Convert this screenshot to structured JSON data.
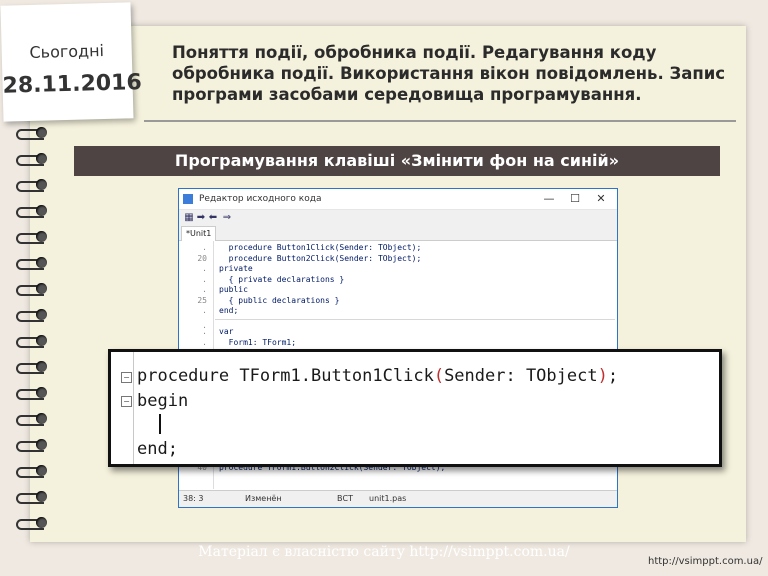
{
  "note": {
    "label": "Сьогодні",
    "date": "28.11.2016"
  },
  "title": "Поняття події, обробника події. Редагування коду обробника події. Використання вікон повідомлень. Запис програми засобами середовища програмування.",
  "banner": "Програмування клавіші «Змінити фон на синій»",
  "window": {
    "title": "Редактор исходного кода",
    "tab": "*Unit1",
    "controls": {
      "min": "—",
      "max": "☐",
      "close": "✕"
    }
  },
  "code_lines": [
    {
      "ln": ".",
      "text": "  procedure Button1Click(Sender: TObject);"
    },
    {
      "ln": "20",
      "text": "  procedure Button2Click(Sender: TObject);"
    },
    {
      "ln": ".",
      "text": "private"
    },
    {
      "ln": ".",
      "text": "  { private declarations }"
    },
    {
      "ln": ".",
      "text": "public"
    },
    {
      "ln": "25",
      "text": "  { public declarations }"
    },
    {
      "ln": ".",
      "text": "end;"
    },
    {
      "ln": ".",
      "text": ""
    },
    {
      "ln": ".",
      "text": "var"
    },
    {
      "ln": ".",
      "text": "  Form1: TForm1;"
    }
  ],
  "bottom_line": {
    "ln": "40",
    "text": "procedure TForm1.Button2Click(Sender: TObject);"
  },
  "status": {
    "pos": "38: 3",
    "state": "Изменён",
    "mode": "ВСТ",
    "file": "unit1.pas"
  },
  "zoom": {
    "line1_a": "procedure TForm1.Button1Click",
    "line1_p1": "(",
    "line1_b": "Sender: TObject",
    "line1_p2": ")",
    "line1_c": ";",
    "line2": "begin",
    "line4": "end;"
  },
  "footer": "Матеріал є власністю сайту http://vsimppt.com.ua/",
  "url": "http://vsimppt.com.ua/",
  "colors": {
    "banner": "#4f4444",
    "paper": "#f4f1dc",
    "window_border": "#2d73c8"
  }
}
